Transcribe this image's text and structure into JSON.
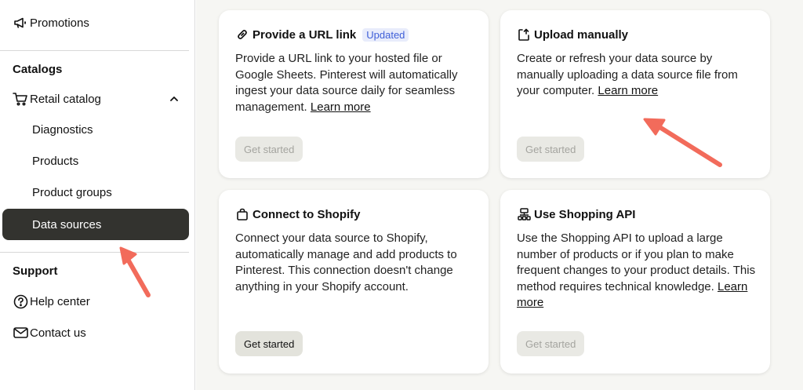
{
  "sidebar": {
    "promotions": "Promotions",
    "catalogs_heading": "Catalogs",
    "retail_catalog": "Retail catalog",
    "items": [
      "Diagnostics",
      "Products",
      "Product groups"
    ],
    "active_item": "Data sources",
    "support_heading": "Support",
    "help_center": "Help center",
    "contact_us": "Contact us"
  },
  "cards": [
    {
      "title": "Provide a URL link",
      "badge": "Updated",
      "description": "Provide a URL link to your hosted file or Google Sheets. Pinterest will automatically ingest your data source daily for seamless management.",
      "learn_more": "Learn more",
      "button": "Get started",
      "button_state": "disabled"
    },
    {
      "title": "Upload manually",
      "description": "Create or refresh your data source by manually uploading a data source file from your computer.",
      "learn_more": "Learn more",
      "button": "Get started",
      "button_state": "disabled"
    },
    {
      "title": "Connect to Shopify",
      "description": "Connect your data source to Shopify, automatically manage and add products to Pinterest. This connection doesn't change anything in your Shopify account.",
      "button": "Get started",
      "button_state": "enabled"
    },
    {
      "title": "Use Shopping API",
      "description": "Use the Shopping API to upload a large number of products or if you plan to make frequent changes to your product details. This method requires technical knowledge.",
      "learn_more": "Learn more",
      "button": "Get started",
      "button_state": "disabled"
    }
  ],
  "colors": {
    "active_bg": "#33332f",
    "badge_bg": "#e8ecfb",
    "badge_text": "#3f5fd8",
    "arrow": "#f26b5b"
  },
  "icons": [
    "megaphone-icon",
    "cart-icon",
    "chevron-up-icon",
    "help-icon",
    "mail-icon",
    "link-icon",
    "upload-icon",
    "shopping-bag-icon",
    "api-icon",
    "annotation-arrow"
  ]
}
